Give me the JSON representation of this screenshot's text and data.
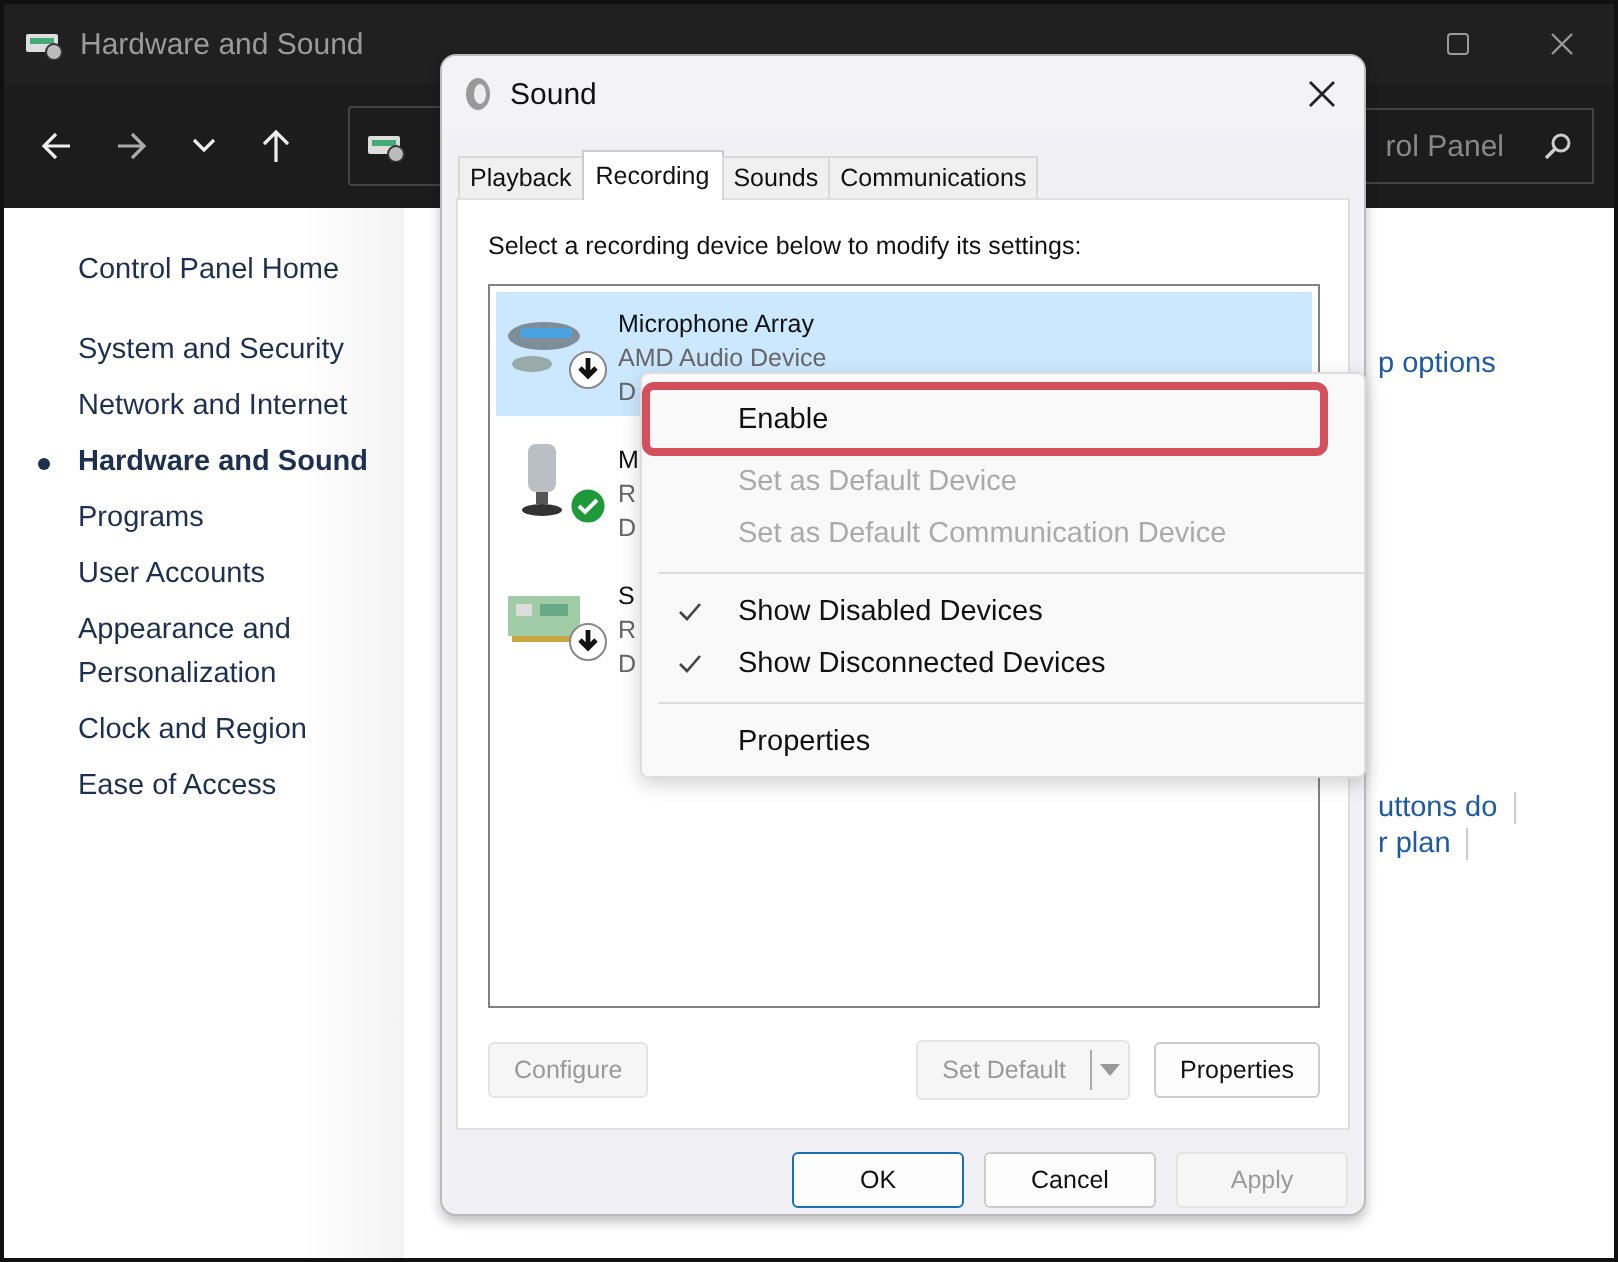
{
  "window": {
    "title": "Hardware and Sound",
    "search_placeholder": "rol Panel"
  },
  "sidebar": {
    "items": [
      {
        "label": "Control Panel Home",
        "kind": "home",
        "selected": false
      },
      {
        "label": "System and Security",
        "kind": "category",
        "selected": false
      },
      {
        "label": "Network and Internet",
        "kind": "category",
        "selected": false
      },
      {
        "label": "Hardware and Sound",
        "kind": "category",
        "selected": true
      },
      {
        "label": "Programs",
        "kind": "category",
        "selected": false
      },
      {
        "label": "User Accounts",
        "kind": "category",
        "selected": false
      },
      {
        "label": "Appearance and Personalization",
        "kind": "category",
        "selected": false
      },
      {
        "label": "Clock and Region",
        "kind": "category",
        "selected": false
      },
      {
        "label": "Ease of Access",
        "kind": "category",
        "selected": false
      }
    ]
  },
  "content_links": [
    {
      "label": "p options",
      "divider": false
    },
    {
      "label": "uttons do",
      "divider": true
    },
    {
      "label": "r plan",
      "divider": true
    }
  ],
  "dialog": {
    "title": "Sound",
    "tabs": [
      {
        "label": "Playback",
        "selected": false
      },
      {
        "label": "Recording",
        "selected": true
      },
      {
        "label": "Sounds",
        "selected": false
      },
      {
        "label": "Communications",
        "selected": false
      }
    ],
    "instruction": "Select a recording device below to modify its settings:",
    "devices": [
      {
        "kind": "mic-array",
        "name": "Microphone Array",
        "description": "AMD Audio Device",
        "status": "D",
        "selected": true,
        "disabled": true,
        "default": false
      },
      {
        "kind": "microphone",
        "name": "M",
        "description": "R",
        "status": "D",
        "selected": false,
        "disabled": false,
        "default": true
      },
      {
        "kind": "card",
        "name": "S",
        "description": "R",
        "status": "D",
        "selected": false,
        "disabled": true,
        "default": false
      }
    ],
    "buttons": [
      {
        "label": "Configure",
        "kind": "plain",
        "disabled": true
      },
      {
        "label": "Set Default",
        "kind": "split",
        "disabled": true
      },
      {
        "label": "Properties",
        "kind": "plain",
        "disabled": false
      }
    ],
    "footer_buttons": [
      {
        "label": "OK",
        "default": true,
        "disabled": false
      },
      {
        "label": "Cancel",
        "default": false,
        "disabled": false
      },
      {
        "label": "Apply",
        "default": false,
        "disabled": true
      }
    ]
  },
  "context_menu": {
    "items": [
      {
        "kind": "item",
        "label": "Enable",
        "disabled": false,
        "checked": false,
        "highlighted": true
      },
      {
        "kind": "item",
        "label": "Set as Default Device",
        "disabled": true,
        "checked": false,
        "highlighted": false
      },
      {
        "kind": "item",
        "label": "Set as Default Communication Device",
        "disabled": true,
        "checked": false,
        "highlighted": false
      },
      {
        "kind": "separator"
      },
      {
        "kind": "item",
        "label": "Show Disabled Devices",
        "disabled": false,
        "checked": true,
        "highlighted": false
      },
      {
        "kind": "item",
        "label": "Show Disconnected Devices",
        "disabled": false,
        "checked": true,
        "highlighted": false
      },
      {
        "kind": "separator"
      },
      {
        "kind": "item",
        "label": "Properties",
        "disabled": false,
        "checked": false,
        "highlighted": false
      }
    ]
  }
}
